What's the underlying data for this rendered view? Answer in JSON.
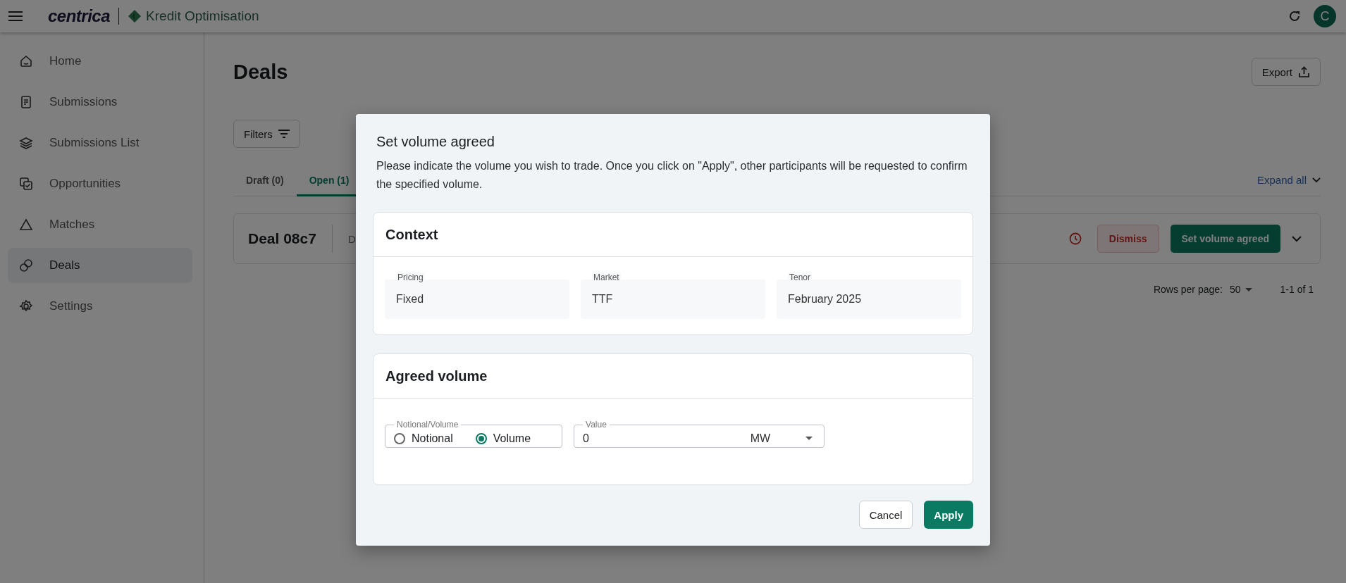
{
  "app_bar": {
    "brand": "centrica",
    "product": "Kredit Optimisation",
    "avatar": "C"
  },
  "sidebar": {
    "items": [
      {
        "label": "Home",
        "selected": false
      },
      {
        "label": "Submissions",
        "selected": false
      },
      {
        "label": "Submissions List",
        "selected": false
      },
      {
        "label": "Opportunities",
        "selected": false
      },
      {
        "label": "Matches",
        "selected": false
      },
      {
        "label": "Deals",
        "selected": true
      },
      {
        "label": "Settings",
        "selected": false
      }
    ]
  },
  "page": {
    "title": "Deals",
    "export_button": "Export",
    "filters_button": "Filters",
    "tabs": [
      {
        "label": "Draft (0)",
        "selected": false
      },
      {
        "label": "Open (1)",
        "selected": true
      }
    ],
    "expand_all": "Expand all",
    "deals": [
      {
        "title": "Deal 08c7",
        "column_2": "D",
        "dismiss": "Dismiss",
        "action": "Set volume agreed"
      }
    ],
    "pagination": {
      "rows_label": "Rows per page:",
      "rows_value": "50",
      "range": "1-1 of 1"
    }
  },
  "dialog": {
    "title": "Set volume agreed",
    "description": "Please indicate the volume you wish to trade. Once you click on \"Apply\", other participants will be requested to confirm the specified volume.",
    "context": {
      "title": "Context",
      "fields": [
        {
          "label": "Pricing",
          "value": "Fixed"
        },
        {
          "label": "Market",
          "value": "TTF"
        },
        {
          "label": "Tenor",
          "value": "February 2025"
        }
      ]
    },
    "agreed_volume": {
      "title": "Agreed volume",
      "mode_group": {
        "legend": "Notional/Volume",
        "options": [
          {
            "label": "Notional",
            "selected": false
          },
          {
            "label": "Volume",
            "selected": true
          }
        ]
      },
      "value_field": {
        "label": "Value",
        "value": "0",
        "unit": "MW"
      }
    },
    "buttons": [
      {
        "label": "Cancel",
        "kind": "secondary"
      },
      {
        "label": "Apply",
        "kind": "primary"
      }
    ]
  }
}
